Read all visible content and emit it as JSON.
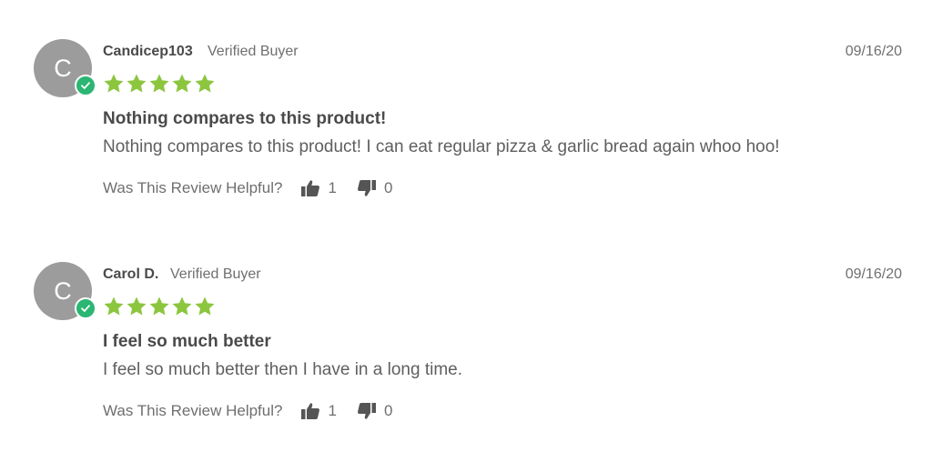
{
  "colors": {
    "star": "#8cc63f",
    "verified_badge": "#2bb673",
    "avatar_bg": "#9c9c9c",
    "text_dark": "#4a4a4a",
    "text_muted": "#6f6f6f"
  },
  "helpful_label": "Was This Review Helpful?",
  "reviews": [
    {
      "avatar_letter": "C",
      "name": "Candicep103",
      "status": "Verified Buyer",
      "date": "09/16/20",
      "rating": 5,
      "title": "Nothing compares to this product!",
      "body": "Nothing compares to this product! I can eat regular pizza & garlic bread again whoo hoo!",
      "upvotes": "1",
      "downvotes": "0"
    },
    {
      "avatar_letter": "C",
      "name": "Carol D.",
      "status": "Verified Buyer",
      "date": "09/16/20",
      "rating": 5,
      "title": "I feel so much better",
      "body": "I feel so much better then I have in a long time.",
      "upvotes": "1",
      "downvotes": "0"
    }
  ]
}
